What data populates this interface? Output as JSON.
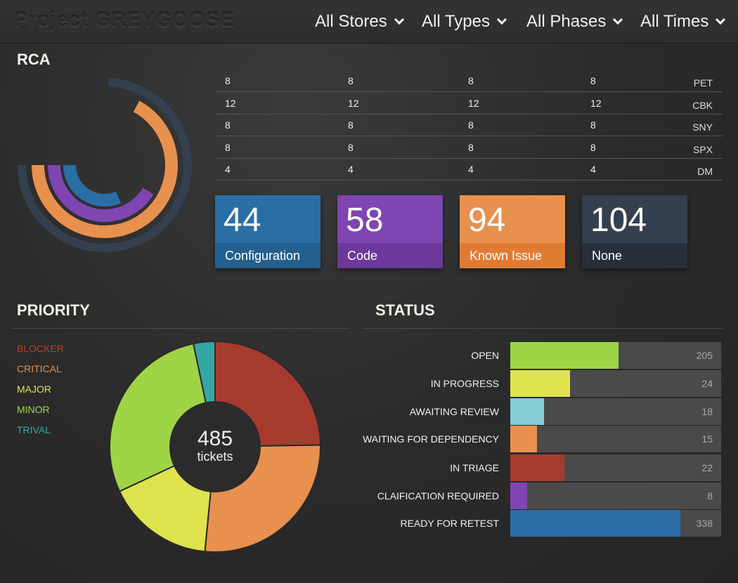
{
  "header": {
    "title": "Project GREYGOOSE",
    "filters": [
      "All Stores",
      "All Types",
      "All Phases",
      "All Times"
    ]
  },
  "rca": {
    "title": "RCA",
    "rows": [
      {
        "label": "PET",
        "values": [
          "8",
          "8",
          "8",
          "8"
        ]
      },
      {
        "label": "CBK",
        "values": [
          "12",
          "12",
          "12",
          "12"
        ]
      },
      {
        "label": "SNY",
        "values": [
          "8",
          "8",
          "8",
          "8"
        ]
      },
      {
        "label": "SPX",
        "values": [
          "8",
          "8",
          "8",
          "8"
        ]
      },
      {
        "label": "DM",
        "values": [
          "4",
          "4",
          "4",
          "4"
        ]
      }
    ],
    "tiles": [
      {
        "value": "44",
        "label": "Configuration",
        "color": "#2a6ea6",
        "dark": "#23608f"
      },
      {
        "value": "58",
        "label": "Code",
        "color": "#7f45b2",
        "dark": "#6c3899"
      },
      {
        "value": "94",
        "label": "Known Issue",
        "color": "#e8904e",
        "dark": "#e07b34"
      },
      {
        "value": "104",
        "label": "None",
        "color": "#34404f",
        "dark": "#262f3a"
      }
    ],
    "rings": [
      {
        "name": "None",
        "value": 104,
        "color": "#34404f"
      },
      {
        "name": "Known Issue",
        "value": 94,
        "color": "#e8904e"
      },
      {
        "name": "Code",
        "value": 58,
        "color": "#7f45b2"
      },
      {
        "name": "Configuration",
        "value": 44,
        "color": "#2a6ea6"
      }
    ]
  },
  "priority": {
    "title": "PRIORITY",
    "legend": [
      {
        "label": "BLOCKER",
        "color": "#c0392b"
      },
      {
        "label": "CRITICAL",
        "color": "#e8904e"
      },
      {
        "label": "MAJOR",
        "color": "#e2e24a"
      },
      {
        "label": "MINOR",
        "color": "#a0d44a"
      },
      {
        "label": "TRIVAL",
        "color": "#36aaa8"
      }
    ],
    "total": "485",
    "total_label": "tickets",
    "slices": [
      {
        "label": "BLOCKER",
        "value": 120,
        "color": "#a63a2f"
      },
      {
        "label": "CRITICAL",
        "value": 130,
        "color": "#e8904e"
      },
      {
        "label": "MAJOR",
        "value": 80,
        "color": "#dfe34d"
      },
      {
        "label": "MINOR",
        "value": 139,
        "color": "#9fd447"
      },
      {
        "label": "TRIVAL",
        "value": 16,
        "color": "#35a6a4"
      }
    ]
  },
  "status": {
    "title": "STATUS",
    "max": 400,
    "rows": [
      {
        "label": "OPEN",
        "value": 205,
        "value_text": "205",
        "color": "#9fd447"
      },
      {
        "label": "IN PROGRESS",
        "value": 113,
        "value_text": "24",
        "color": "#dfe34d"
      },
      {
        "label": "AWAITING REVIEW",
        "value": 64,
        "value_text": "18",
        "color": "#86cdd4"
      },
      {
        "label": "WAITING FOR DEPENDENCY",
        "value": 51,
        "value_text": "15",
        "color": "#e8904e"
      },
      {
        "label": "IN TRIAGE",
        "value": 103,
        "value_text": "22",
        "color": "#a63a2f"
      },
      {
        "label": "CLAIFICATION REQUIRED",
        "value": 32,
        "value_text": "8",
        "color": "#7f45b2"
      },
      {
        "label": "READY FOR RETEST",
        "value": 323,
        "value_text": "338",
        "color": "#2a6ea6"
      }
    ]
  }
}
